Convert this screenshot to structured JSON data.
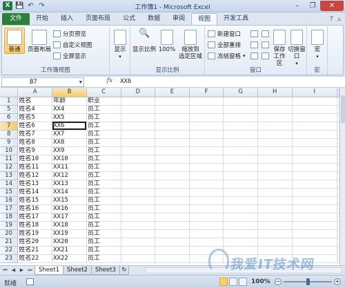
{
  "window": {
    "title": "工作簿1 - Microsoft Excel",
    "app_icon": "X",
    "controls": [
      "minimize",
      "restore",
      "close"
    ]
  },
  "qat": [
    "save-icon",
    "undo-icon",
    "redo-icon"
  ],
  "tabs": [
    {
      "label": "文件",
      "state": "file"
    },
    {
      "label": "开始"
    },
    {
      "label": "插入"
    },
    {
      "label": "页面布局"
    },
    {
      "label": "公式"
    },
    {
      "label": "数据"
    },
    {
      "label": "审阅"
    },
    {
      "label": "视图",
      "state": "active"
    },
    {
      "label": "开发工具"
    }
  ],
  "ribbon": {
    "workbook_views": {
      "label": "工作簿视图",
      "normal": "普通",
      "page_layout": "页面布局",
      "page_break": "分页预览",
      "custom_view": "自定义视图",
      "full_screen": "全屏显示"
    },
    "show": {
      "label": "显示"
    },
    "zoom": {
      "label": "显示比例",
      "zoom": "显示比例",
      "hundred": "100%",
      "to_selection_1": "缩放到",
      "to_selection_2": "选定区域"
    },
    "window": {
      "label": "窗口",
      "new_window": "新建窗口",
      "arrange_all": "全部重排",
      "freeze_panes": "冻结窗格",
      "save_workspace_1": "保存",
      "save_workspace_2": "工作区",
      "switch_windows": "切换窗口"
    },
    "macros": {
      "label": "宏",
      "macro": "宏"
    }
  },
  "formula_bar": {
    "name_box": "B7",
    "fx": "fx",
    "value": "XX6"
  },
  "columns": [
    "A",
    "B",
    "C",
    "D",
    "E",
    "F",
    "G",
    "H",
    "I"
  ],
  "rows": [
    {
      "n": "1",
      "a": "姓名",
      "b": "年龄",
      "c": "职业"
    },
    {
      "n": "5",
      "a": "姓名4",
      "b": "XX4",
      "c": "员工"
    },
    {
      "n": "6",
      "a": "姓名5",
      "b": "XX5",
      "c": "员工"
    },
    {
      "n": "7",
      "a": "姓名6",
      "b": "XX6",
      "c": "员工"
    },
    {
      "n": "8",
      "a": "姓名7",
      "b": "XX7",
      "c": "员工"
    },
    {
      "n": "9",
      "a": "姓名8",
      "b": "XX8",
      "c": "员工"
    },
    {
      "n": "10",
      "a": "姓名9",
      "b": "XX9",
      "c": "员工"
    },
    {
      "n": "11",
      "a": "姓名10",
      "b": "XX10",
      "c": "员工"
    },
    {
      "n": "12",
      "a": "姓名11",
      "b": "XX11",
      "c": "员工"
    },
    {
      "n": "13",
      "a": "姓名12",
      "b": "XX12",
      "c": "员工"
    },
    {
      "n": "14",
      "a": "姓名13",
      "b": "XX13",
      "c": "员工"
    },
    {
      "n": "15",
      "a": "姓名14",
      "b": "XX14",
      "c": "员工"
    },
    {
      "n": "16",
      "a": "姓名15",
      "b": "XX15",
      "c": "员工"
    },
    {
      "n": "17",
      "a": "姓名16",
      "b": "XX16",
      "c": "员工"
    },
    {
      "n": "18",
      "a": "姓名17",
      "b": "XX17",
      "c": "员工"
    },
    {
      "n": "19",
      "a": "姓名18",
      "b": "XX18",
      "c": "员工"
    },
    {
      "n": "20",
      "a": "姓名19",
      "b": "XX19",
      "c": "员工"
    },
    {
      "n": "21",
      "a": "姓名20",
      "b": "XX20",
      "c": "员工"
    },
    {
      "n": "22",
      "a": "姓名21",
      "b": "XX21",
      "c": "员工"
    },
    {
      "n": "23",
      "a": "姓名22",
      "b": "XX22",
      "c": "员工"
    }
  ],
  "active_cell": {
    "row": "7",
    "col": "B"
  },
  "sheets": [
    {
      "label": "Sheet1",
      "active": true
    },
    {
      "label": "Sheet2"
    },
    {
      "label": "Sheet3"
    }
  ],
  "status": {
    "ready": "就绪",
    "zoom": "100%",
    "zoom_fraction": 0.5
  },
  "watermark": "我爱IT技术网"
}
